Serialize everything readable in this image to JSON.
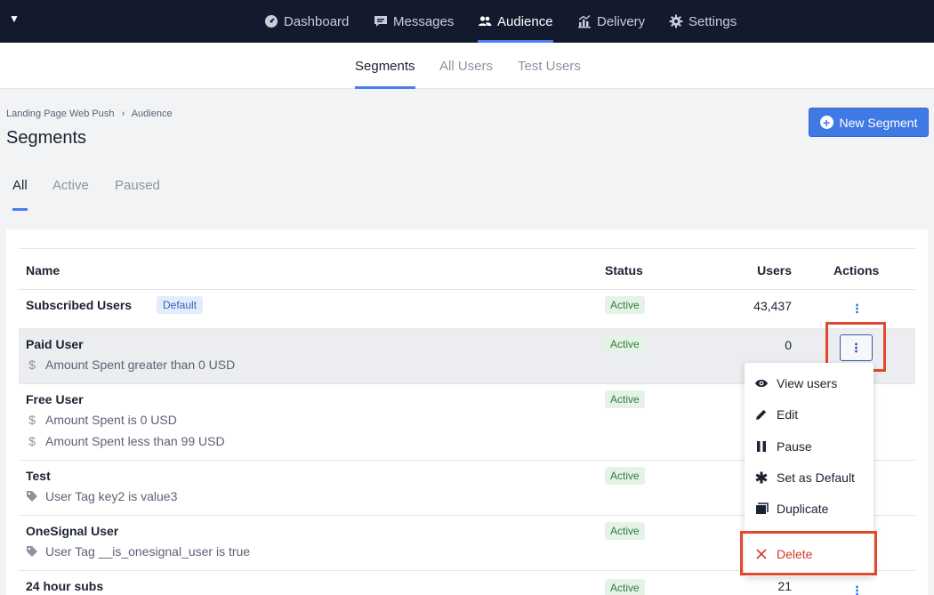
{
  "top_nav": {
    "items": [
      {
        "label": "Dashboard",
        "icon": "dashboard-icon",
        "active": false
      },
      {
        "label": "Messages",
        "icon": "messages-icon",
        "active": false
      },
      {
        "label": "Audience",
        "icon": "audience-icon",
        "active": true
      },
      {
        "label": "Delivery",
        "icon": "delivery-icon",
        "active": false
      },
      {
        "label": "Settings",
        "icon": "gear-icon",
        "active": false
      }
    ]
  },
  "sub_nav": {
    "tabs": [
      {
        "label": "Segments",
        "active": true
      },
      {
        "label": "All Users",
        "active": false
      },
      {
        "label": "Test Users",
        "active": false
      }
    ]
  },
  "breadcrumb": {
    "app": "Landing Page Web Push",
    "separator": "›",
    "section": "Audience"
  },
  "page_title": "Segments",
  "new_segment_label": "New Segment",
  "filters": [
    {
      "label": "All",
      "active": true
    },
    {
      "label": "Active",
      "active": false
    },
    {
      "label": "Paused",
      "active": false
    }
  ],
  "table": {
    "headers": {
      "name": "Name",
      "status": "Status",
      "users": "Users",
      "actions": "Actions"
    },
    "rows": [
      {
        "name": "Subscribed Users",
        "badge": "Default",
        "status": "Active",
        "users": "43,437",
        "conditions": []
      },
      {
        "name": "Paid User",
        "status": "Active",
        "users": "0",
        "conditions": [
          {
            "icon": "dollar-icon",
            "text": "Amount Spent greater than 0 USD"
          }
        ]
      },
      {
        "name": "Free User",
        "status": "Active",
        "users": "",
        "conditions": [
          {
            "icon": "dollar-icon",
            "text": "Amount Spent is 0 USD"
          },
          {
            "icon": "dollar-icon",
            "text": "Amount Spent less than 99 USD"
          }
        ]
      },
      {
        "name": "Test",
        "status": "Active",
        "users": "",
        "conditions": [
          {
            "icon": "tag-icon",
            "text": "User Tag key2 is value3"
          }
        ]
      },
      {
        "name": "OneSignal User",
        "status": "Active",
        "users": "",
        "conditions": [
          {
            "icon": "tag-icon",
            "text": "User Tag __is_onesignal_user is true"
          }
        ]
      },
      {
        "name": "24 hour subs",
        "status": "Active",
        "users": "21",
        "conditions": []
      }
    ]
  },
  "actions_menu": {
    "items": [
      {
        "label": "View users",
        "icon": "eye-icon"
      },
      {
        "label": "Edit",
        "icon": "pencil-icon"
      },
      {
        "label": "Pause",
        "icon": "pause-icon"
      },
      {
        "label": "Set as Default",
        "icon": "asterisk-icon"
      },
      {
        "label": "Duplicate",
        "icon": "duplicate-icon"
      },
      {
        "label": "Delete",
        "icon": "close-icon"
      }
    ]
  },
  "colors": {
    "nav_bg": "#141a2e",
    "accent": "#3f7ae4",
    "highlight_box": "#e0492c",
    "danger": "#d23b2a"
  }
}
